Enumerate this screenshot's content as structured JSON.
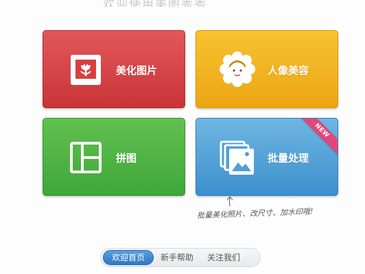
{
  "header": {
    "partial_title": "欢迎使用美图秀秀"
  },
  "tiles": [
    {
      "label": "美化图片",
      "icon": "flower-photo-icon",
      "color": "#d6403f"
    },
    {
      "label": "人像美容",
      "icon": "face-icon",
      "color": "#f2b320"
    },
    {
      "label": "拼图",
      "icon": "collage-grid-icon",
      "color": "#4db443"
    },
    {
      "label": "批量处理",
      "icon": "photo-stack-icon",
      "color": "#4fa0d8",
      "badge": "NEW"
    }
  ],
  "annotation": {
    "text": "批量美化照片、改尺寸、加水印哦!"
  },
  "nav": {
    "items": [
      {
        "label": "欢迎首页",
        "active": true
      },
      {
        "label": "新手帮助",
        "active": false
      },
      {
        "label": "关注我们",
        "active": false
      }
    ]
  }
}
